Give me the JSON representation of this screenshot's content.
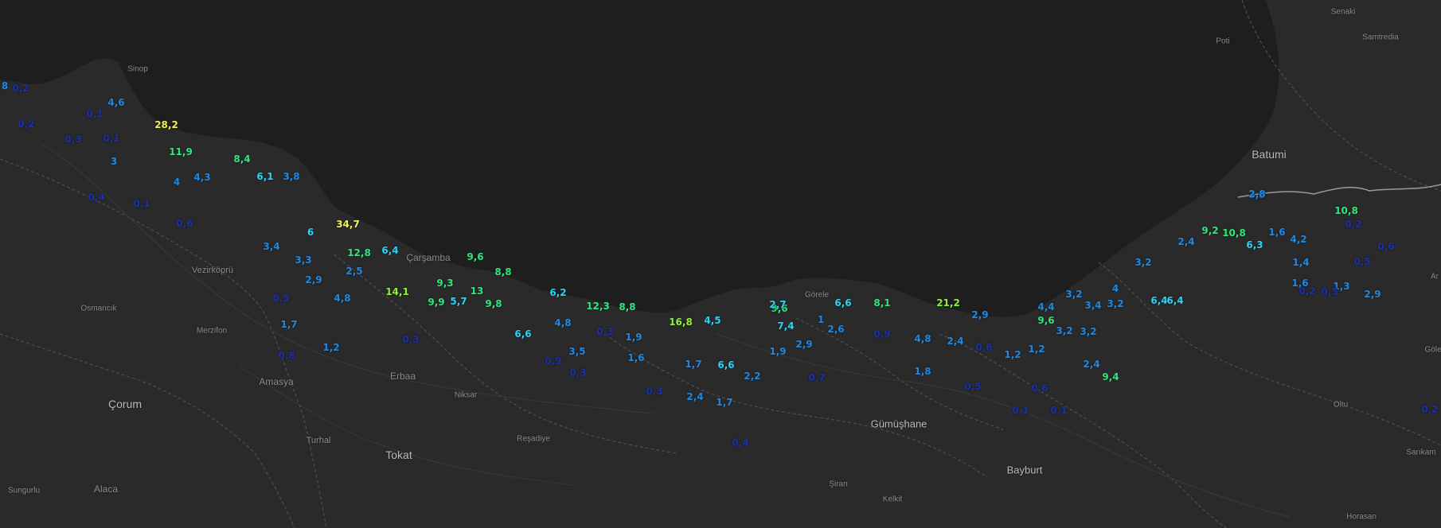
{
  "map": {
    "places": [
      {
        "name": "Sinop",
        "big": false
      },
      {
        "name": "Vezirköprü",
        "big": false
      },
      {
        "name": "Osmancık",
        "big": false
      },
      {
        "name": "Merzifon",
        "big": false
      },
      {
        "name": "Amasya",
        "big": false
      },
      {
        "name": "Çorum",
        "big": true
      },
      {
        "name": "Turhal",
        "big": false
      },
      {
        "name": "Tokat",
        "big": true
      },
      {
        "name": "Sungurlu",
        "big": false
      },
      {
        "name": "Alaca",
        "big": false
      },
      {
        "name": "Erbaa",
        "big": false
      },
      {
        "name": "Niksar",
        "big": false
      },
      {
        "name": "Reşadiye",
        "big": false
      },
      {
        "name": "Çarşamba",
        "big": false
      },
      {
        "name": "Görele",
        "big": false
      },
      {
        "name": "Gümüşhane",
        "big": true
      },
      {
        "name": "Şiran",
        "big": false
      },
      {
        "name": "Kelkit",
        "big": false
      },
      {
        "name": "Bayburt",
        "big": true
      },
      {
        "name": "Batumi",
        "big": true
      },
      {
        "name": "Poti",
        "big": false
      },
      {
        "name": "Senaki",
        "big": false
      },
      {
        "name": "Samtredia",
        "big": false
      },
      {
        "name": "Oltu",
        "big": false
      },
      {
        "name": "Horasan",
        "big": false
      },
      {
        "name": "Sarıkam",
        "big": false
      },
      {
        "name": "Göle",
        "big": false
      },
      {
        "name": "Ar",
        "big": false
      }
    ],
    "colors": {
      "land": "#2b2b2b",
      "sea": "#1c1c1c",
      "border": "#5a5a5a",
      "v_low": "#1b2fa8",
      "v_mid": "#1e88e5",
      "v_high": "#2ad2f5",
      "v_green": "#2ee67a",
      "v_lime": "#8ef03c",
      "v_yellow": "#f0f04a"
    },
    "values": [
      {
        "text": "8",
        "level": "mid"
      },
      {
        "text": "0,2",
        "level": "low"
      },
      {
        "text": "4,6",
        "level": "mid"
      },
      {
        "text": "0,1",
        "level": "low"
      },
      {
        "text": "0,2",
        "level": "low"
      },
      {
        "text": "28,2",
        "level": "yellow"
      },
      {
        "text": "0,3",
        "level": "low"
      },
      {
        "text": "0,1",
        "level": "low"
      },
      {
        "text": "11,9",
        "level": "green"
      },
      {
        "text": "3",
        "level": "mid"
      },
      {
        "text": "8,4",
        "level": "green"
      },
      {
        "text": "6,1",
        "level": "high"
      },
      {
        "text": "3,8",
        "level": "mid"
      },
      {
        "text": "4,3",
        "level": "mid"
      },
      {
        "text": "4",
        "level": "mid"
      },
      {
        "text": "0,4",
        "level": "low"
      },
      {
        "text": "0,1",
        "level": "low"
      },
      {
        "text": "0,6",
        "level": "low"
      },
      {
        "text": "6",
        "level": "high"
      },
      {
        "text": "34,7",
        "level": "yellow"
      },
      {
        "text": "3,4",
        "level": "mid"
      },
      {
        "text": "12,8",
        "level": "green"
      },
      {
        "text": "6,4",
        "level": "high"
      },
      {
        "text": "3,3",
        "level": "mid"
      },
      {
        "text": "9,6",
        "level": "green"
      },
      {
        "text": "2,5",
        "level": "mid"
      },
      {
        "text": "8,8",
        "level": "green"
      },
      {
        "text": "2,9",
        "level": "mid"
      },
      {
        "text": "9,3",
        "level": "green"
      },
      {
        "text": "14,1",
        "level": "lime"
      },
      {
        "text": "13",
        "level": "green"
      },
      {
        "text": "0,5",
        "level": "low"
      },
      {
        "text": "4,8",
        "level": "mid"
      },
      {
        "text": "9,9",
        "level": "green"
      },
      {
        "text": "5,7",
        "level": "high"
      },
      {
        "text": "9,8",
        "level": "green"
      },
      {
        "text": "6,2",
        "level": "high"
      },
      {
        "text": "12,3",
        "level": "green"
      },
      {
        "text": "8,8",
        "level": "green"
      },
      {
        "text": "1,7",
        "level": "mid"
      },
      {
        "text": "4,8",
        "level": "mid"
      },
      {
        "text": "0,3",
        "level": "low"
      },
      {
        "text": "16,8",
        "level": "lime"
      },
      {
        "text": "4,5",
        "level": "high"
      },
      {
        "text": "6,6",
        "level": "high"
      },
      {
        "text": "0,3",
        "level": "low"
      },
      {
        "text": "0,8",
        "level": "low"
      },
      {
        "text": "1,2",
        "level": "mid"
      },
      {
        "text": "3,5",
        "level": "mid"
      },
      {
        "text": "0,9",
        "level": "low"
      },
      {
        "text": "0,3",
        "level": "low"
      },
      {
        "text": "1,6",
        "level": "mid"
      },
      {
        "text": "1,7",
        "level": "mid"
      },
      {
        "text": "6,6",
        "level": "high"
      },
      {
        "text": "1,9",
        "level": "mid"
      },
      {
        "text": "9,6",
        "level": "green"
      },
      {
        "text": "2,7",
        "level": "high"
      },
      {
        "text": "7,4",
        "level": "high"
      },
      {
        "text": "1",
        "level": "mid"
      },
      {
        "text": "6,6",
        "level": "high"
      },
      {
        "text": "8,1",
        "level": "green"
      },
      {
        "text": "2,6",
        "level": "mid"
      },
      {
        "text": "1,9",
        "level": "mid"
      },
      {
        "text": "2,9",
        "level": "mid"
      },
      {
        "text": "2,2",
        "level": "mid"
      },
      {
        "text": "0,7",
        "level": "low"
      },
      {
        "text": "0,3",
        "level": "low"
      },
      {
        "text": "2,4",
        "level": "mid"
      },
      {
        "text": "1,7",
        "level": "mid"
      },
      {
        "text": "0,4",
        "level": "low"
      },
      {
        "text": "0,9",
        "level": "low"
      },
      {
        "text": "4,8",
        "level": "mid"
      },
      {
        "text": "21,2",
        "level": "lime"
      },
      {
        "text": "2,9",
        "level": "mid"
      },
      {
        "text": "2,4",
        "level": "mid"
      },
      {
        "text": "0,6",
        "level": "low"
      },
      {
        "text": "1,8",
        "level": "mid"
      },
      {
        "text": "0,5",
        "level": "low"
      },
      {
        "text": "9,6",
        "level": "green"
      },
      {
        "text": "1,2",
        "level": "mid"
      },
      {
        "text": "1,2",
        "level": "mid"
      },
      {
        "text": "4,4",
        "level": "mid"
      },
      {
        "text": "3,2",
        "level": "mid"
      },
      {
        "text": "3,2",
        "level": "mid"
      },
      {
        "text": "3,4",
        "level": "mid"
      },
      {
        "text": "4",
        "level": "mid"
      },
      {
        "text": "3,2",
        "level": "mid"
      },
      {
        "text": "3,2",
        "level": "mid"
      },
      {
        "text": "0,6",
        "level": "low"
      },
      {
        "text": "0,1",
        "level": "low"
      },
      {
        "text": "0,1",
        "level": "low"
      },
      {
        "text": "2,4",
        "level": "mid"
      },
      {
        "text": "9,4",
        "level": "green"
      },
      {
        "text": "3,2",
        "level": "mid"
      },
      {
        "text": "6,4",
        "level": "high"
      },
      {
        "text": "6,4",
        "level": "high"
      },
      {
        "text": "2,4",
        "level": "mid"
      },
      {
        "text": "10,8",
        "level": "green"
      },
      {
        "text": "9,2",
        "level": "green"
      },
      {
        "text": "3,9",
        "level": "mid"
      },
      {
        "text": "1,6",
        "level": "mid"
      },
      {
        "text": "4,2",
        "level": "mid"
      },
      {
        "text": "10,8",
        "level": "green"
      },
      {
        "text": "6,3",
        "level": "high"
      },
      {
        "text": "1,4",
        "level": "mid"
      },
      {
        "text": "1,6",
        "level": "mid"
      },
      {
        "text": "2,8",
        "level": "mid"
      },
      {
        "text": "0,2",
        "level": "low"
      },
      {
        "text": "0,6",
        "level": "low"
      },
      {
        "text": "1,3",
        "level": "mid"
      },
      {
        "text": "0,5",
        "level": "low"
      },
      {
        "text": "0,2",
        "level": "low"
      },
      {
        "text": "0,5",
        "level": "low"
      },
      {
        "text": "2,9",
        "level": "mid"
      },
      {
        "text": "0,2",
        "level": "low"
      }
    ]
  }
}
